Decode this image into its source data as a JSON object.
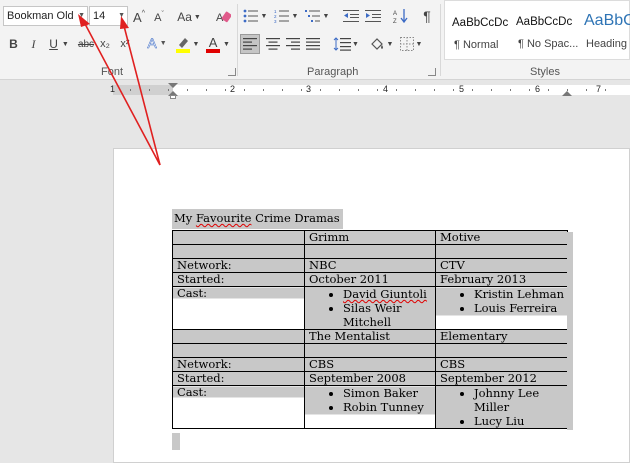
{
  "ribbon": {
    "font": {
      "name": "Bookman Old",
      "size": "14",
      "group_label": "Font"
    },
    "paragraph": {
      "group_label": "Paragraph"
    },
    "styles": {
      "group_label": "Styles",
      "items": [
        {
          "sample": "AaBbCcDc",
          "name": "¶ Normal"
        },
        {
          "sample": "AaBbCcDc",
          "name": "¶ No Spac..."
        },
        {
          "sample": "AaBbC",
          "name": "Heading"
        }
      ]
    },
    "labels": {
      "grow": "A",
      "shrink": "A",
      "case": "Aa",
      "bold": "B",
      "italic": "I",
      "underline": "U",
      "strike": "abc",
      "subscript": "x₂",
      "superscript": "x²",
      "effects": "A",
      "fontcolor": "A",
      "pilcrow": "¶"
    }
  },
  "ruler": {
    "numbers": [
      "1",
      "2",
      "3",
      "4",
      "5",
      "6",
      "7"
    ]
  },
  "document": {
    "title_pre": "My ",
    "title_misspelled": "Favourite",
    "title_post": " Crime Dramas",
    "table": {
      "row_header1": [
        "",
        "Grimm",
        "Motive"
      ],
      "network_label": "Network:",
      "network1": [
        "NBC",
        "CTV"
      ],
      "started_label": "Started:",
      "started1": [
        "October 2011",
        "February 2013"
      ],
      "cast_label": "Cast:",
      "cast1_grimm": [
        "David Giuntoli",
        "Silas Weir Mitchell"
      ],
      "cast1_motive": [
        "Kristin Lehman",
        "Louis Ferreira"
      ],
      "row_header2": [
        "",
        "The Mentalist",
        "Elementary"
      ],
      "network2": [
        "CBS",
        "CBS"
      ],
      "started2": [
        "September 2008",
        "September 2012"
      ],
      "cast2_mentalist": [
        "Simon Baker",
        "Robin Tunney"
      ],
      "cast2_elementary": [
        "Johnny Lee Miller",
        "Lucy Liu"
      ]
    }
  },
  "colors": {
    "arrow": "#e02020",
    "highlight": "#ffff00",
    "font_color": "#e00000",
    "spell_error": "#e00000"
  }
}
